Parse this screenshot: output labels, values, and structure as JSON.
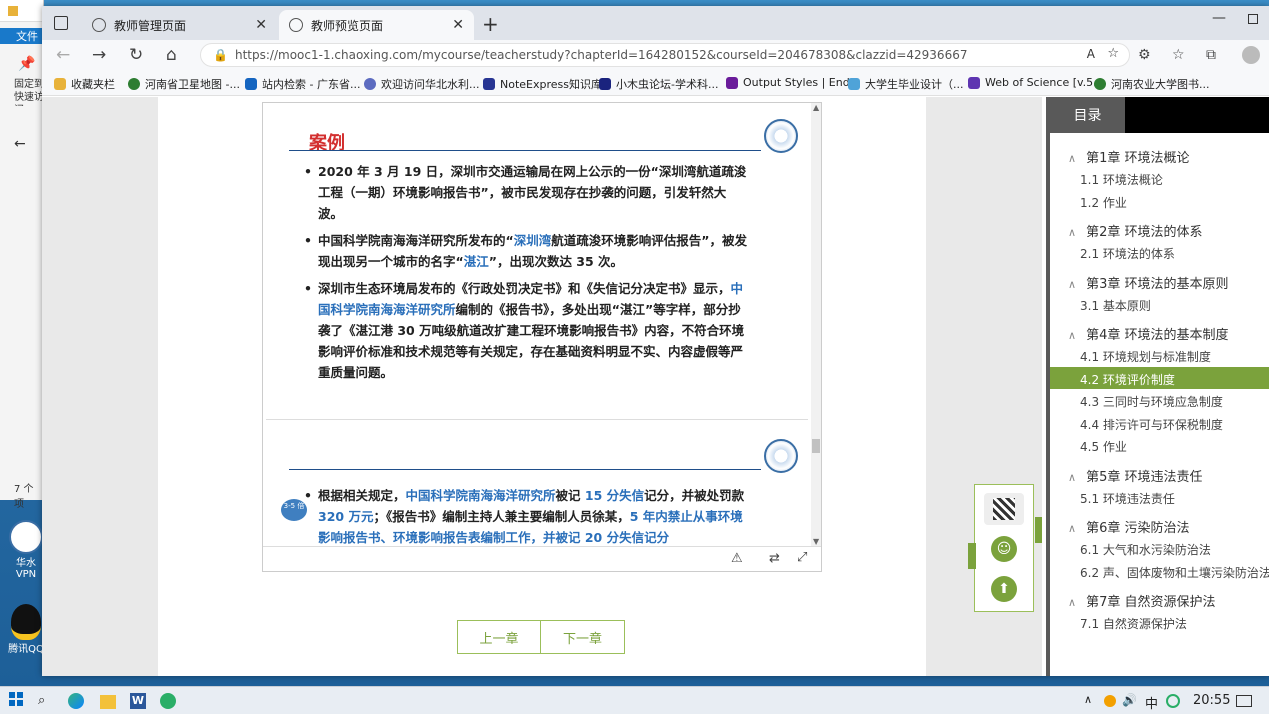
{
  "desktop": {
    "explorer_menu_label": "文件",
    "explorer_pin_text": "固定到快速访问",
    "explorer_items_count": "7 个项",
    "icons": [
      {
        "label": "华水VPN"
      },
      {
        "label": "腾讯QQ"
      }
    ]
  },
  "browser": {
    "tabs": [
      {
        "label": "教师管理页面",
        "active": false
      },
      {
        "label": "教师预览页面",
        "active": true
      }
    ],
    "url": "https://mooc1-1.chaoxing.com/mycourse/teacherstudy?chapterId=164280152&courseId=204678308&clazzid=42936667",
    "bookmarks": [
      {
        "label": "收藏夹栏",
        "color": "#e8b23a"
      },
      {
        "label": "河南省卫星地图 -...",
        "color": "#2e7d32"
      },
      {
        "label": "站内检索 - 广东省...",
        "color": "#1565c0"
      },
      {
        "label": "欢迎访问华北水利...",
        "color": "#5c6bc0"
      },
      {
        "label": "NoteExpress知识库",
        "color": "#283593"
      },
      {
        "label": "小木虫论坛-学术科...",
        "color": "#1a237e"
      },
      {
        "label": "Output Styles | End...",
        "color": "#6a1b9a"
      },
      {
        "label": "大学生毕业设计（...",
        "color": "#4fa3d8"
      },
      {
        "label": "Web of Science [v.5...",
        "color": "#5e35b1"
      },
      {
        "label": "河南农业大学图书...",
        "color": "#2e7d32"
      }
    ]
  },
  "slide1": {
    "title": "案例",
    "bullets": [
      [
        {
          "t": "2020 年 3 月 19 日，深圳市交通运输局在网上公示的一份“深圳湾航道疏浚工程（一期）环境影响报告书”，被市民发现存在抄袭的问题，引发轩然大波。"
        }
      ],
      [
        {
          "t": "中国科学院南海海洋研究所发布的“"
        },
        {
          "t": "深圳湾",
          "hl": true
        },
        {
          "t": "航道疏浚环境影响评估报告”，被发现出现另一个城市的名字“"
        },
        {
          "t": "湛江",
          "hl": true
        },
        {
          "t": "”，出现次数达 35 次。"
        }
      ],
      [
        {
          "t": "深圳市生态环境局发布的《行政处罚决定书》和《失信记分决定书》显示，"
        },
        {
          "t": "中国科学院南海海洋研究所",
          "hl": true
        },
        {
          "t": "编制的《报告书》，多处出现“湛江”等字样，部分抄袭了《湛江港 30 万吨级航道改扩建工程环境影响报告书》内容，不符合环境影响评价标准和技术规范等有关规定，存在基础资料明显不实、内容虚假等严重质量问题。"
        }
      ]
    ]
  },
  "slide2": {
    "badge": "3-5 倍",
    "bullets": [
      [
        {
          "t": "根据相关规定，"
        },
        {
          "t": "中国科学院南海海洋研究所",
          "hl": true
        },
        {
          "t": "被记 "
        },
        {
          "t": "15 分失信",
          "hl": true
        },
        {
          "t": "记分，并被处罚款 "
        },
        {
          "t": "320 万元",
          "hl": true
        },
        {
          "t": "；《报告书》编制主持人兼主要编制人员徐某，"
        },
        {
          "t": "5 年内禁止从事环境影响报告书、环境影响报告表编制工作，并被记 20 分失信记分",
          "hl": true
        }
      ]
    ]
  },
  "pager": {
    "prev": "上一章",
    "next": "下一章"
  },
  "sidebar": {
    "header": "目录",
    "chapters": [
      {
        "title": "第1章 环境法概论",
        "sections": [
          {
            "label": "1.1 环境法概论"
          },
          {
            "label": "1.2 作业"
          }
        ]
      },
      {
        "title": "第2章 环境法的体系",
        "sections": [
          {
            "label": "2.1 环境法的体系"
          }
        ]
      },
      {
        "title": "第3章 环境法的基本原则",
        "sections": [
          {
            "label": "3.1 基本原则"
          }
        ]
      },
      {
        "title": "第4章 环境法的基本制度",
        "sections": [
          {
            "label": "4.1 环境规划与标准制度"
          },
          {
            "label": "4.2 环境评价制度",
            "active": true
          },
          {
            "label": "4.3 三同时与环境应急制度"
          },
          {
            "label": "4.4 排污许可与环保税制度"
          },
          {
            "label": "4.5 作业"
          }
        ]
      },
      {
        "title": "第5章 环境违法责任",
        "sections": [
          {
            "label": "5.1 环境违法责任"
          }
        ]
      },
      {
        "title": "第6章 污染防治法",
        "sections": [
          {
            "label": "6.1 大气和水污染防治法"
          },
          {
            "label": "6.2 声、固体废物和土壤污染防治法"
          }
        ]
      },
      {
        "title": "第7章 自然资源保护法",
        "sections": [
          {
            "label": "7.1 自然资源保护法"
          }
        ]
      }
    ]
  },
  "taskbar": {
    "time": "20:55",
    "ime": "中"
  },
  "colors": {
    "accent": "#7ba23c",
    "title_red": "#d32f2f",
    "highlight_blue": "#2a6fba"
  }
}
